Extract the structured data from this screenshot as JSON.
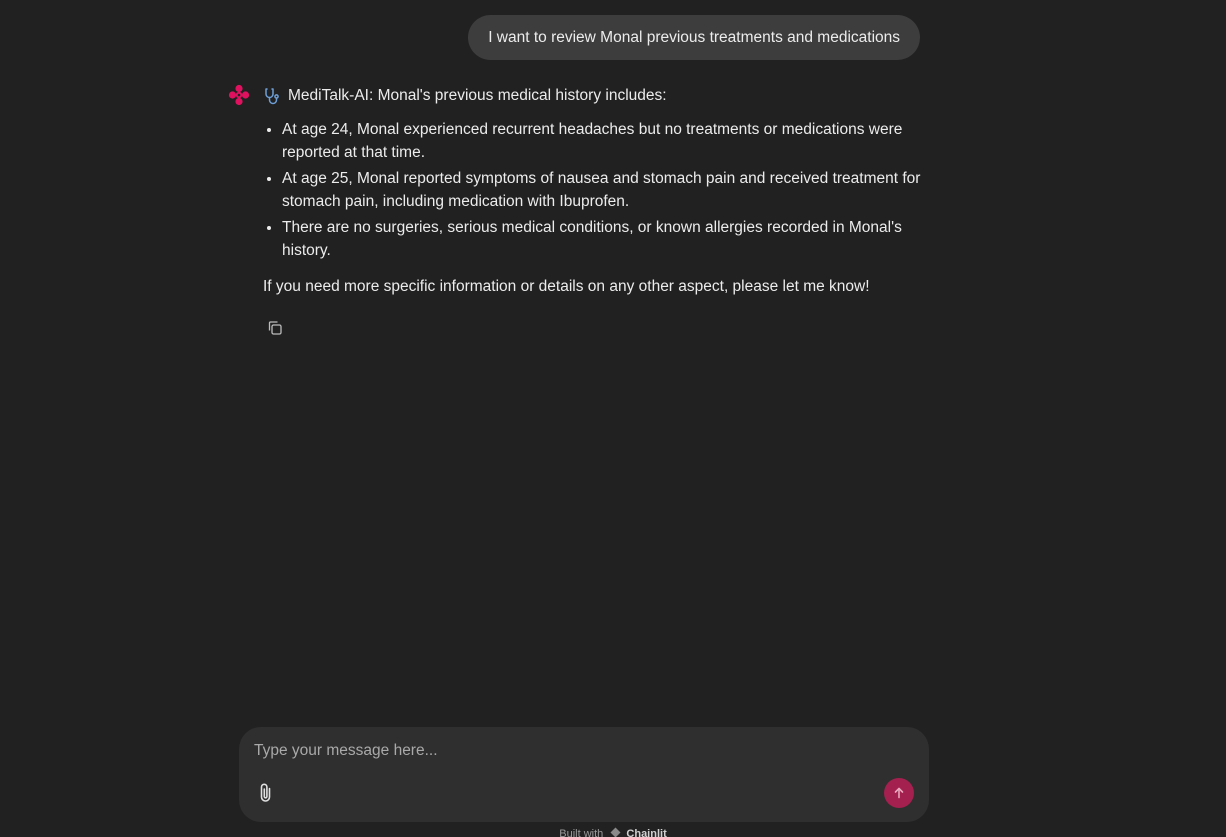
{
  "user_message": "I want to review Monal previous treatments and medications",
  "assistant": {
    "avatar_icon": "pink-flower-logo-icon",
    "heading_icon": "stethoscope-icon",
    "heading": "MediTalk-AI: Monal's previous medical history includes:",
    "items": [
      "At age 24, Monal experienced recurrent headaches but no treatments or medications were reported at that time.",
      "At age 25, Monal reported symptoms of nausea and stomach pain and received treatment for stomach pain, including medication with Ibuprofen.",
      "There are no surgeries, serious medical conditions, or known allergies recorded in Monal's history."
    ],
    "closing": "If you need more specific information or details on any other aspect, please let me know!",
    "copy_icon": "copy-icon"
  },
  "composer": {
    "placeholder": "Type your message here...",
    "value": "",
    "attach_icon": "paperclip-icon",
    "send_icon": "arrow-up-icon"
  },
  "footer": {
    "built_with": "Built with",
    "brand": "Chainlit"
  },
  "colors": {
    "background": "#212121",
    "user_bubble": "#3d3d3d",
    "composer": "#2f2f2f",
    "accent": "#e0125f",
    "send_button": "#a3204f"
  }
}
